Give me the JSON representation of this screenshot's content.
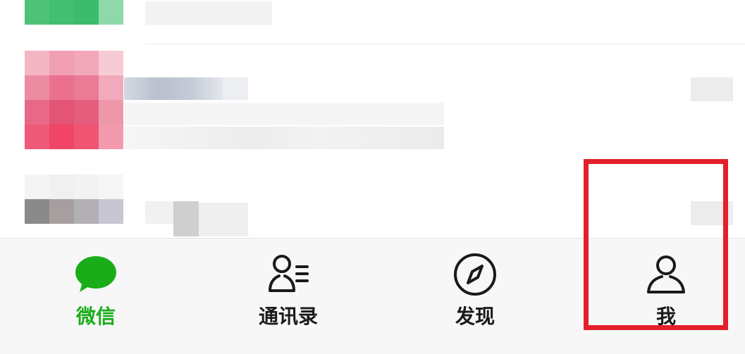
{
  "colors": {
    "accent": "#1aad19",
    "highlight": "#e3202a",
    "text": "#1a1a1a",
    "tabbar_bg": "#f7f7f7"
  },
  "tabbar": {
    "tabs": [
      {
        "label": "微信",
        "icon": "chat-bubble-icon",
        "active": true
      },
      {
        "label": "通讯录",
        "icon": "contacts-icon",
        "active": false
      },
      {
        "label": "发现",
        "icon": "compass-icon",
        "active": false
      },
      {
        "label": "我",
        "icon": "profile-icon",
        "active": false
      }
    ]
  }
}
